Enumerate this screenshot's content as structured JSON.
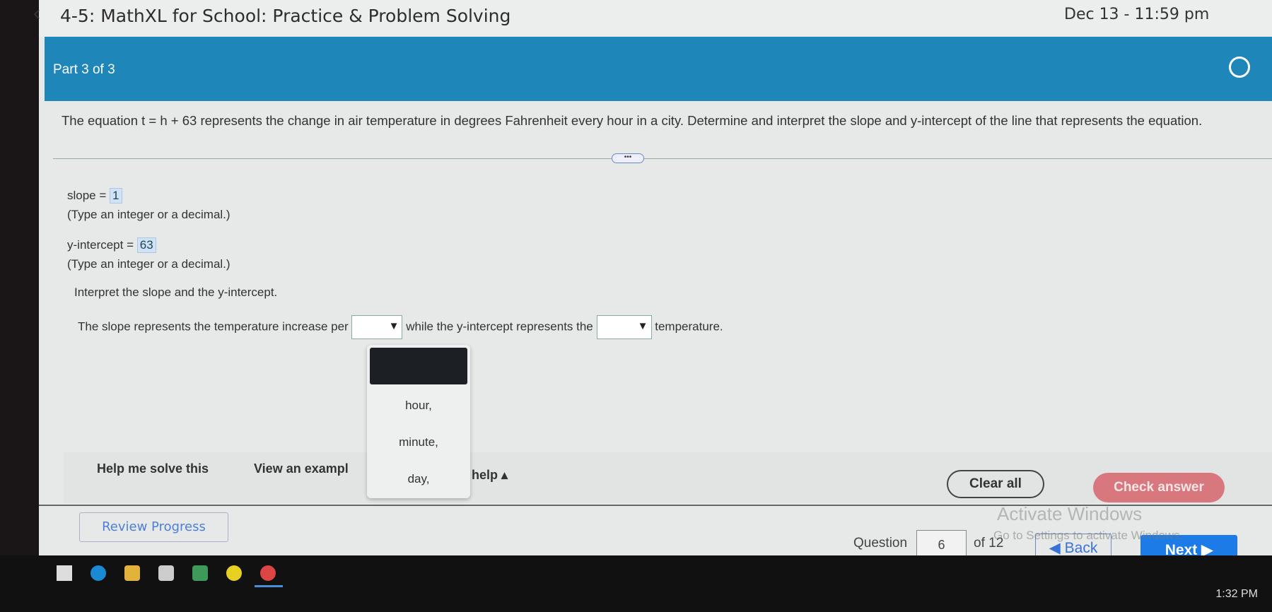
{
  "header": {
    "title": "4-5: MathXL for School: Practice & Problem Solving",
    "datetime": "Dec 13 - 11:59 pm"
  },
  "part": "Part 3 of 3",
  "question": "The equation t = h + 63 represents the change in air temperature in degrees Fahrenheit every hour in a city. Determine and interpret the slope and y-intercept of the line that represents the equation.",
  "slope": {
    "label": "slope =",
    "value": "1",
    "hint": "(Type an integer or a decimal.)"
  },
  "intercept": {
    "label": "y-intercept =",
    "value": "63",
    "hint": "(Type an integer or a decimal.)"
  },
  "interpret": "Interpret the slope and the y-intercept.",
  "sentence": {
    "part1": "The slope represents the temperature increase per",
    "part2": "while the y-intercept represents the",
    "part3": "temperature."
  },
  "dropdown_options": [
    "hour,",
    "minute,",
    "day,"
  ],
  "help": {
    "solve": "Help me solve this",
    "example": "View an exampl",
    "more": "help ▴"
  },
  "buttons": {
    "clear": "Clear all",
    "check": "Check answer",
    "review": "Review Progress",
    "back": "◀ Back",
    "next": "Next ▶"
  },
  "nav": {
    "question_label": "Question",
    "question_number": "6",
    "of": "of 12"
  },
  "watermark": {
    "line1": "Activate Windows",
    "line2": "Go to Settings to activate Windows."
  },
  "taskbar": {
    "time": "1:32 PM"
  },
  "colors": {
    "header_blue": "#1e86b8",
    "check_answer": "#d9777e",
    "next": "#1c7be6"
  }
}
